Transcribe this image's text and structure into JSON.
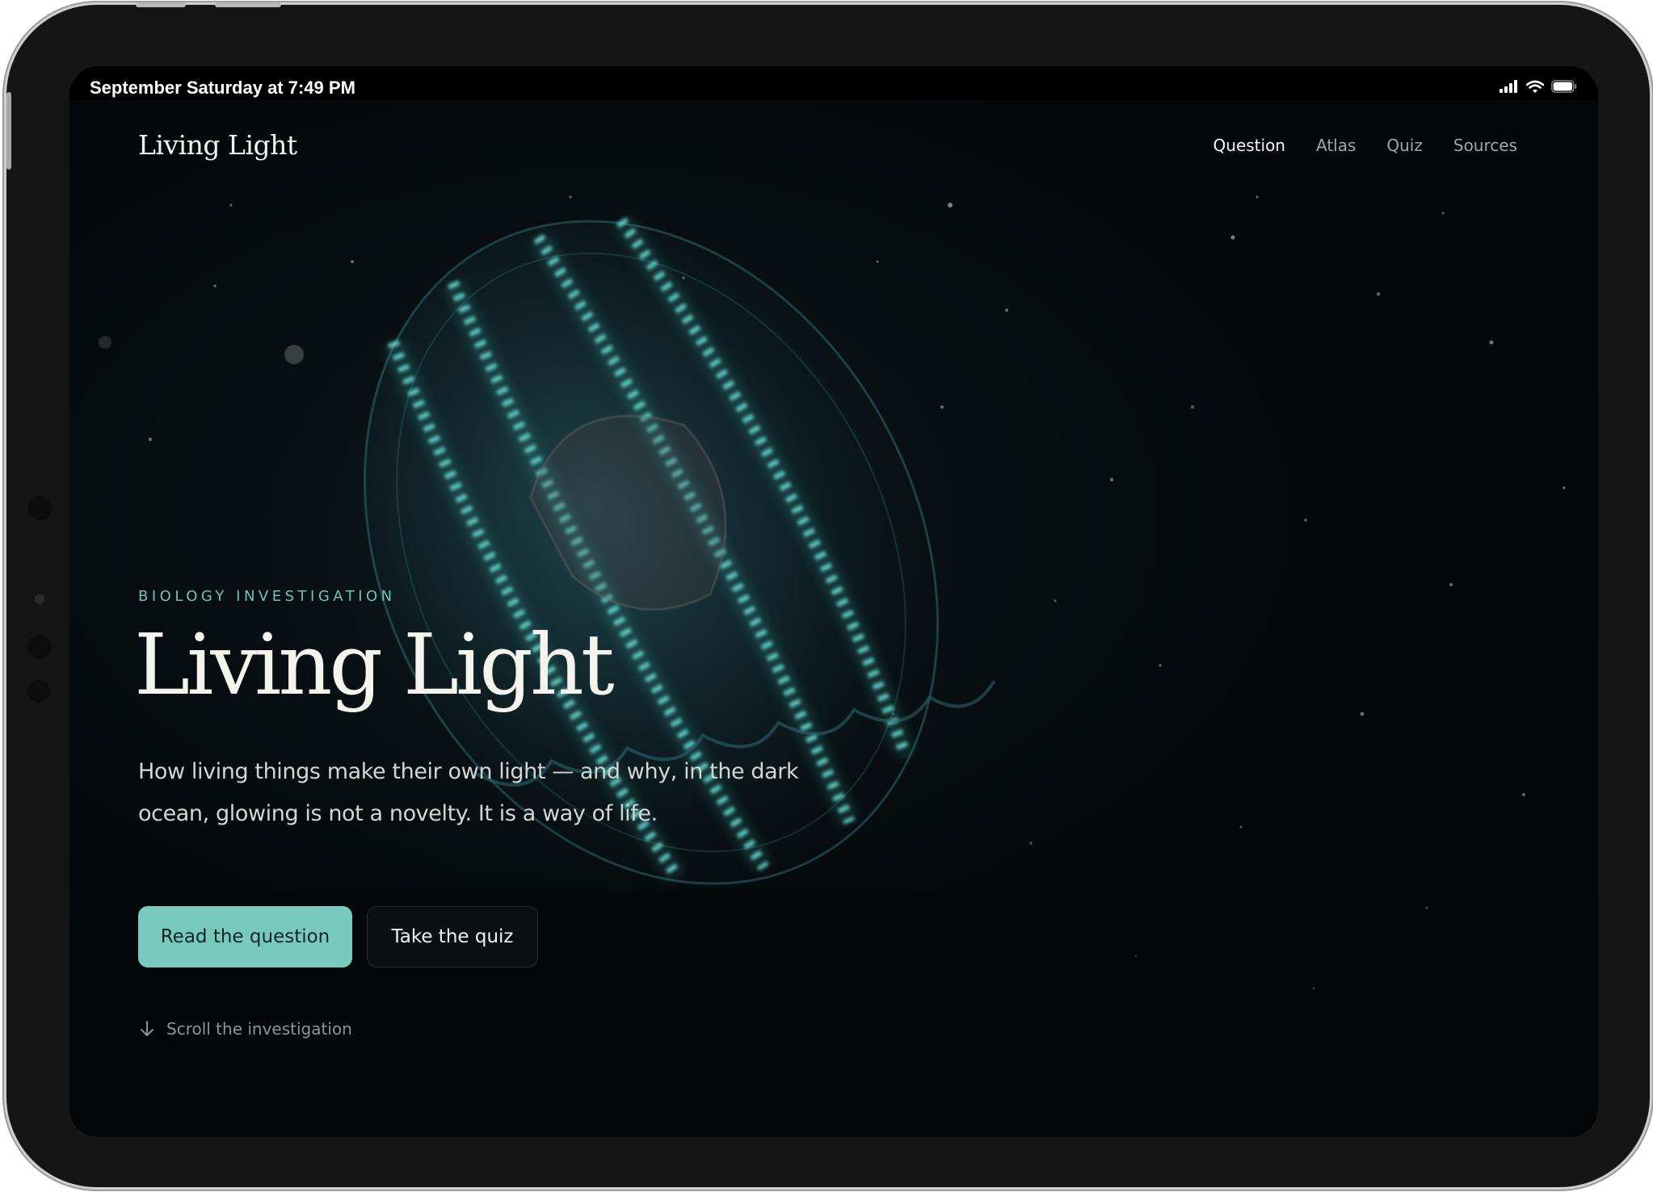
{
  "status_bar": {
    "time": "September Saturday at 7:49 PM"
  },
  "site": {
    "brand": "Living Light"
  },
  "nav": {
    "items": [
      {
        "label": "Question",
        "active": true
      },
      {
        "label": "Atlas",
        "active": false
      },
      {
        "label": "Quiz",
        "active": false
      },
      {
        "label": "Sources",
        "active": false
      }
    ]
  },
  "hero": {
    "eyebrow": "BIOLOGY INVESTIGATION",
    "title": "Living Light",
    "subtitle_line1": "How living things make their own light — and why, in the dark",
    "subtitle_line2": "ocean, glowing is not a novelty. It is a way of life.",
    "primary_button": "Read the question",
    "secondary_button": "Take the quiz",
    "scroll_hint": "Scroll the investigation",
    "background_image": "glowing-jellyfish-deep-ocean"
  },
  "colors": {
    "accent": "#79cabe",
    "eyebrow": "#6fc4b8",
    "background": "#050608",
    "text": "#f4f4ef"
  },
  "icons": {
    "signal": "cellular-signal-icon",
    "wifi": "wifi-icon",
    "battery": "battery-icon",
    "scroll": "arrow-down-icon"
  }
}
